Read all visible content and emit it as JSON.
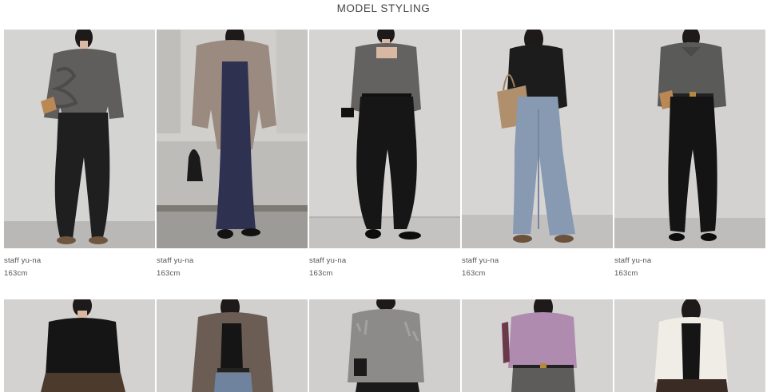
{
  "section": {
    "title": "MODEL STYLING"
  },
  "rows": [
    [
      {
        "name": "staff yu-na",
        "height": "163cm",
        "look": "grey ruffle knit, black wide pants"
      },
      {
        "name": "staff yu-na",
        "height": "163cm",
        "look": "taupe faux fur coat, navy knit dress"
      },
      {
        "name": "staff yu-na",
        "height": "163cm",
        "look": "grey square-neck knit, black balloon pants"
      },
      {
        "name": "staff yu-na",
        "height": "163cm",
        "look": "black cardigan, light denim flare jeans"
      },
      {
        "name": "staff yu-na",
        "height": "163cm",
        "look": "grey polo-collar knit, black wide slacks"
      }
    ],
    [
      {
        "look": "black knit, brown skirt"
      },
      {
        "look": "brown faux fur jacket, denim"
      },
      {
        "look": "grey shaggy knit"
      },
      {
        "look": "lavender ribbed knit, grey pants"
      },
      {
        "look": "ivory cardigan, black inner"
      }
    ]
  ],
  "colors": {
    "background": "#ffffff",
    "text": "#555555",
    "photo_wall": "#d6d6d6",
    "photo_floor": "#bdbdbd"
  }
}
